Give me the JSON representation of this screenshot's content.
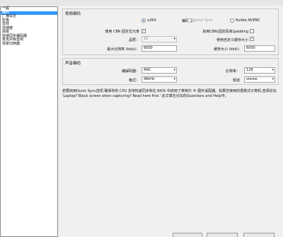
{
  "sidebar": {
    "items": [
      {
        "label": "一般"
      },
      {
        "label": "编码"
      },
      {
        "label": "广播设定"
      },
      {
        "label": "影像"
      },
      {
        "label": "音效"
      },
      {
        "label": "快捷键"
      },
      {
        "label": "高级"
      },
      {
        "label": "快速同步编码器"
      },
      {
        "label": "麦克风噪音闸"
      },
      {
        "label": "场景切换器"
      }
    ],
    "selected_index": 1
  },
  "video": {
    "title": "视频编码",
    "encoder_label": "编码器：",
    "encoders": [
      {
        "label": "x264"
      },
      {
        "label": "Quick Sync"
      },
      {
        "label": "Nvidia NVENC"
      }
    ],
    "cbr_label": "使用 CBR 固定位元率",
    "cbr_padding_label": "启用CBR(固定码率)padding",
    "quality_label": "品质：",
    "quality_value": "10",
    "custom_buffer_label": "使用自定义缓存大小",
    "max_bitrate_label": "最大比特率 (kb/s)：",
    "max_bitrate_value": "6000",
    "buffer_size_label": "缓存大小 (kbit)：",
    "buffer_size_value": "6000"
  },
  "audio": {
    "title": "声音编码",
    "codec_label": "编解码器：",
    "codec_value": "AAC",
    "bitrate_label": "比特率：",
    "bitrate_value": "128",
    "format_label": "格式：",
    "format_value": "48kHz",
    "channel_label": "频道",
    "channel_value": "stereo"
  },
  "note": "若要启用Quick Sync选项,确保你的 CPU 支持快速同步和在 BIOS 中启用了英特尔 ® 图形适配器。如果您使用的便携式计算机,查阅论坛 'Laptop? Black screen when capturing? Read here first.' 此文章在论坛的Questions and Help中。",
  "colors": {
    "selected_bg": "#3399ff",
    "window_bg": "#f0f0f0"
  }
}
